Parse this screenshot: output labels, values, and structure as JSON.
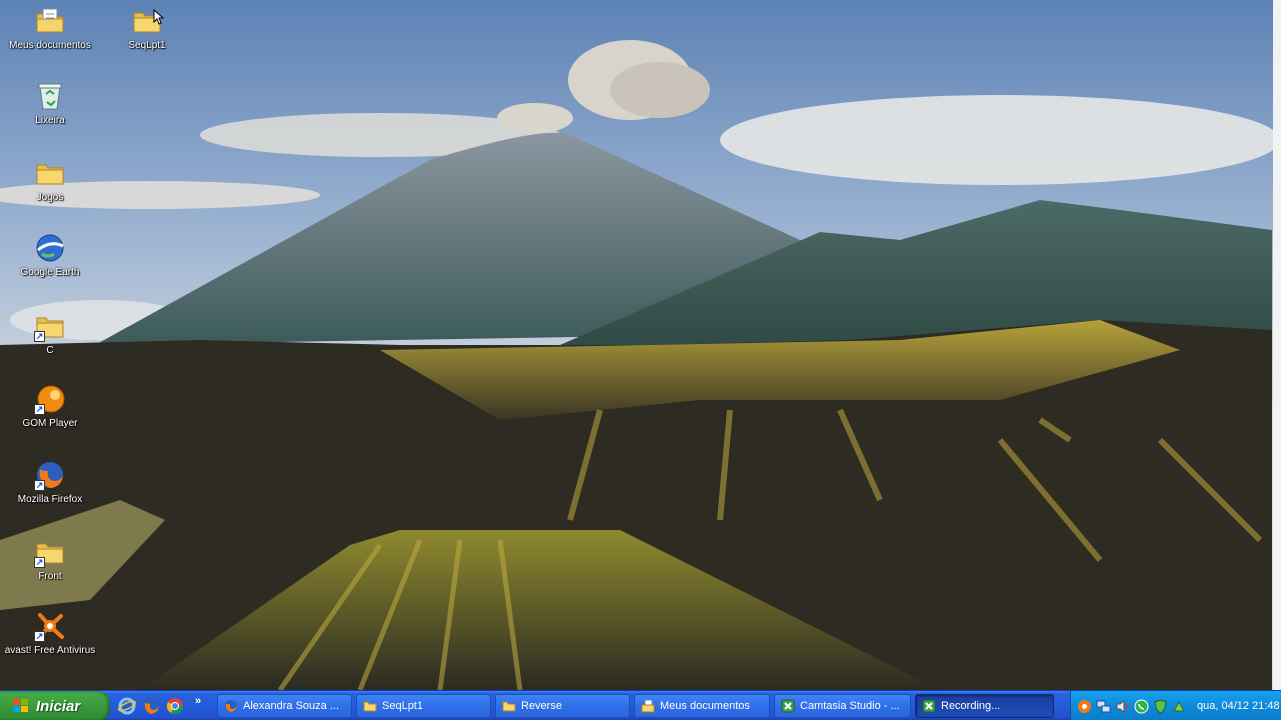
{
  "desktop": {
    "icons": [
      {
        "label": "Meus documentos",
        "icon": "my-documents-icon"
      },
      {
        "label": "SeqLpt1",
        "icon": "folder-icon"
      },
      {
        "label": "Lixeira",
        "icon": "recycle-bin-icon"
      },
      {
        "label": "Jogos",
        "icon": "folder-icon"
      },
      {
        "label": "Google Earth",
        "icon": "google-earth-icon"
      },
      {
        "label": "C",
        "icon": "folder-shortcut-icon"
      },
      {
        "label": "GOM Player",
        "icon": "gom-player-icon"
      },
      {
        "label": "Mozilla Firefox",
        "icon": "firefox-icon"
      },
      {
        "label": "Front",
        "icon": "folder-shortcut-icon"
      },
      {
        "label": "avast! Free Antivirus",
        "icon": "avast-icon"
      }
    ]
  },
  "taskbar": {
    "start_label": "Iniciar",
    "quicklaunch": [
      "ie-icon",
      "firefox-icon",
      "chrome-icon"
    ],
    "more_label": "»",
    "tasks": [
      {
        "label": "Alexandra Souza ...",
        "icon": "firefox-icon",
        "active": false
      },
      {
        "label": "SeqLpt1",
        "icon": "folder-icon",
        "active": false
      },
      {
        "label": "Reverse",
        "icon": "folder-icon",
        "active": false
      },
      {
        "label": "Meus documentos",
        "icon": "my-documents-icon",
        "active": false
      },
      {
        "label": "Camtasia Studio - ...",
        "icon": "camtasia-icon",
        "active": false
      },
      {
        "label": "Recording...",
        "icon": "camtasia-recorder-icon",
        "active": true
      }
    ],
    "tray_icons": [
      "avast-tray-icon",
      "network-icon",
      "volume-icon",
      "whatsapp-icon",
      "antivirus-shield-icon",
      "safely-remove-icon"
    ],
    "clock": "qua, 04/12 21:48"
  },
  "colors": {
    "taskbar_blue": "#245bd8",
    "start_green": "#3c9c3e",
    "tray_blue": "#0e8ad9"
  }
}
